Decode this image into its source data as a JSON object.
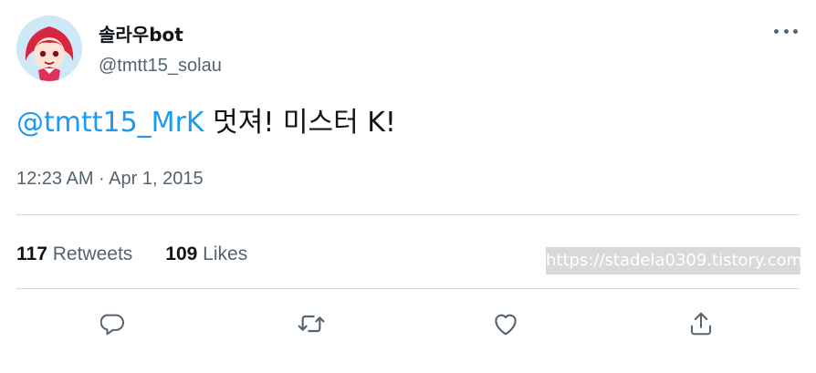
{
  "author": {
    "display_name": "솔라우bot",
    "handle": "@tmtt15_solau",
    "avatar_icon": "anime-avatar"
  },
  "tweet": {
    "mention": "@tmtt15_MrK",
    "text": " 멋져! 미스터 K!",
    "timestamp": "12:23 AM · Apr 1, 2015"
  },
  "stats": {
    "retweets_count": "117",
    "retweets_label": "Retweets",
    "likes_count": "109",
    "likes_label": "Likes"
  },
  "watermark": "https://stadela0309.tistory.com",
  "actions": {
    "reply_icon": "reply-icon",
    "retweet_icon": "retweet-icon",
    "like_icon": "heart-icon",
    "share_icon": "share-icon"
  },
  "colors": {
    "accent": "#1d9bf0",
    "secondary_text": "#536471",
    "primary_text": "#0f1419",
    "divider": "#cfd9de"
  }
}
